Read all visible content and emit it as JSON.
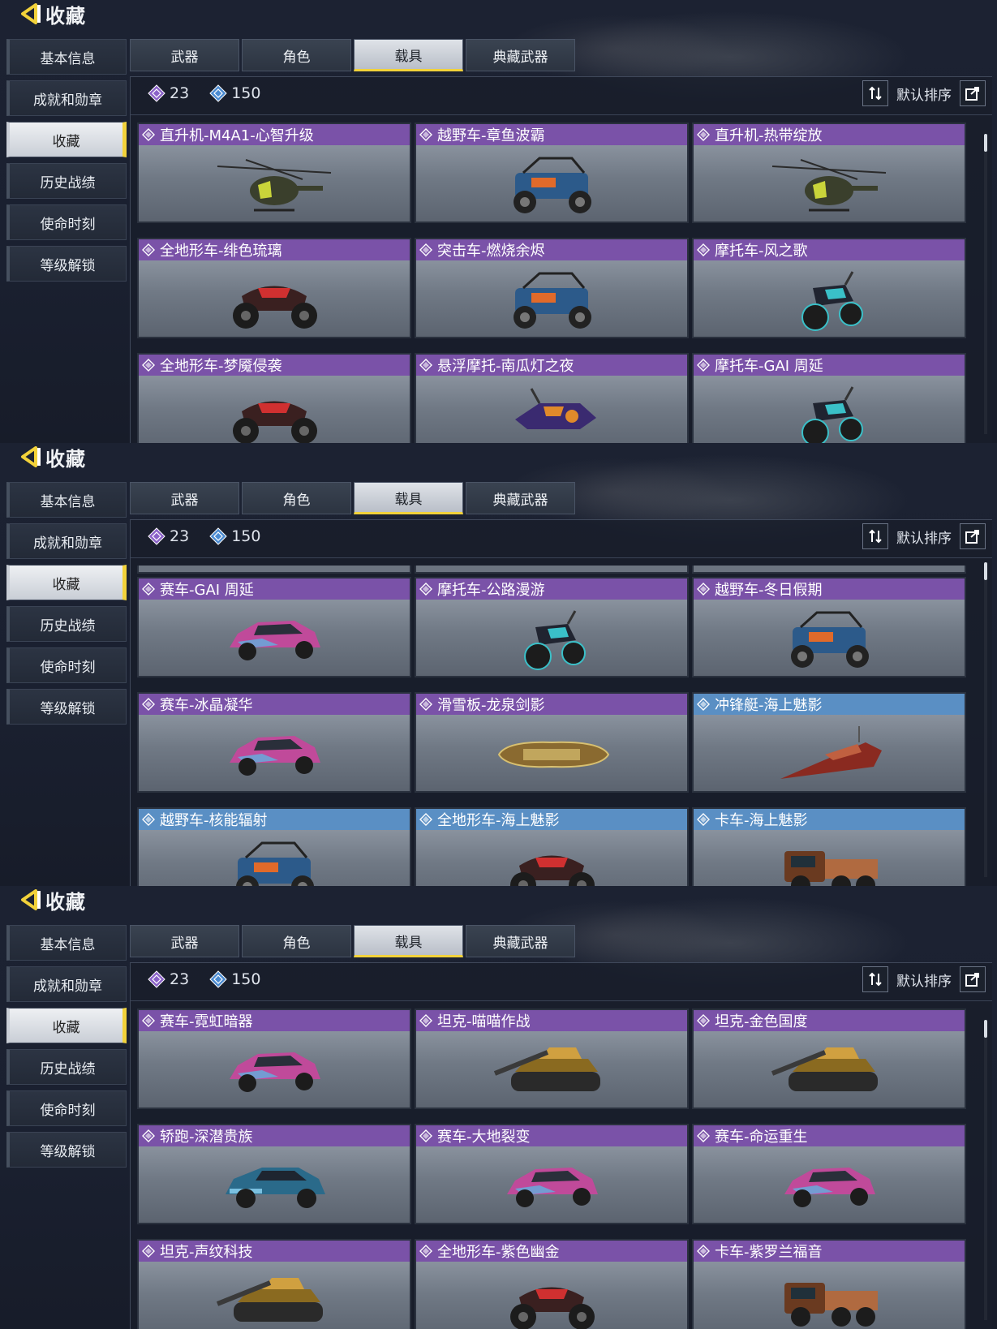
{
  "colors": {
    "accent_yellow": "#f2d23a",
    "purple_header": "#7a52a8",
    "blue_header": "#5a8fc4"
  },
  "panels": [
    {
      "title": "收藏",
      "side_menu": [
        "基本信息",
        "成就和勋章",
        "收藏",
        "历史战绩",
        "使命时刻",
        "等级解锁"
      ],
      "active_side": "收藏",
      "tabs": [
        "武器",
        "角色",
        "载具",
        "典藏武器"
      ],
      "active_tab": "载具",
      "stat_purple": "23",
      "stat_blue": "150",
      "sort_label": "默认排序",
      "cards": [
        {
          "label": "直升机-M4A1-心智升级",
          "color": "purple",
          "icon": "helicopter-icon"
        },
        {
          "label": "越野车-章鱼波霸",
          "color": "purple",
          "icon": "buggy-icon"
        },
        {
          "label": "直升机-热带绽放",
          "color": "purple",
          "icon": "helicopter-icon"
        },
        {
          "label": "全地形车-绯色琉璃",
          "color": "purple",
          "icon": "atv-icon"
        },
        {
          "label": "突击车-燃烧余烬",
          "color": "purple",
          "icon": "buggy-icon"
        },
        {
          "label": "摩托车-风之歌",
          "color": "purple",
          "icon": "motorcycle-icon"
        },
        {
          "label": "全地形车-梦魇侵袭",
          "color": "purple",
          "icon": "atv-icon"
        },
        {
          "label": "悬浮摩托-南瓜灯之夜",
          "color": "purple",
          "icon": "hoverbike-icon"
        },
        {
          "label": "摩托车-GAI 周延",
          "color": "purple",
          "icon": "motorcycle-icon"
        }
      ]
    },
    {
      "title": "收藏",
      "side_menu": [
        "基本信息",
        "成就和勋章",
        "收藏",
        "历史战绩",
        "使命时刻",
        "等级解锁"
      ],
      "active_side": "收藏",
      "tabs": [
        "武器",
        "角色",
        "载具",
        "典藏武器"
      ],
      "active_tab": "载具",
      "stat_purple": "23",
      "stat_blue": "150",
      "sort_label": "默认排序",
      "cards": [
        {
          "label": "赛车-GAI 周延",
          "color": "purple",
          "icon": "race-car-icon"
        },
        {
          "label": "摩托车-公路漫游",
          "color": "purple",
          "icon": "motorcycle-icon"
        },
        {
          "label": "越野车-冬日假期",
          "color": "purple",
          "icon": "buggy-icon"
        },
        {
          "label": "赛车-冰晶凝华",
          "color": "purple",
          "icon": "race-car-icon"
        },
        {
          "label": "滑雪板-龙泉剑影",
          "color": "purple",
          "icon": "snowboard-icon"
        },
        {
          "label": "冲锋艇-海上魅影",
          "color": "blue",
          "icon": "speedboat-icon"
        },
        {
          "label": "越野车-核能辐射",
          "color": "blue",
          "icon": "buggy-icon"
        },
        {
          "label": "全地形车-海上魅影",
          "color": "blue",
          "icon": "atv-icon"
        },
        {
          "label": "卡车-海上魅影",
          "color": "blue",
          "icon": "truck-icon"
        }
      ]
    },
    {
      "title": "收藏",
      "side_menu": [
        "基本信息",
        "成就和勋章",
        "收藏",
        "历史战绩",
        "使命时刻",
        "等级解锁"
      ],
      "active_side": "收藏",
      "tabs": [
        "武器",
        "角色",
        "载具",
        "典藏武器"
      ],
      "active_tab": "载具",
      "stat_purple": "23",
      "stat_blue": "150",
      "sort_label": "默认排序",
      "cards": [
        {
          "label": "赛车-霓虹暗器",
          "color": "purple",
          "icon": "race-car-icon"
        },
        {
          "label": "坦克-喵喵作战",
          "color": "purple",
          "icon": "tank-icon"
        },
        {
          "label": "坦克-金色国度",
          "color": "purple",
          "icon": "tank-icon"
        },
        {
          "label": "轿跑-深潜贵族",
          "color": "purple",
          "icon": "coupe-icon"
        },
        {
          "label": "赛车-大地裂变",
          "color": "purple",
          "icon": "race-car-icon"
        },
        {
          "label": "赛车-命运重生",
          "color": "purple",
          "icon": "race-car-icon"
        },
        {
          "label": "坦克-声纹科技",
          "color": "purple",
          "icon": "tank-icon"
        },
        {
          "label": "全地形车-紫色幽金",
          "color": "purple",
          "icon": "atv-icon"
        },
        {
          "label": "卡车-紫罗兰福音",
          "color": "purple",
          "icon": "truck-icon"
        }
      ]
    }
  ]
}
